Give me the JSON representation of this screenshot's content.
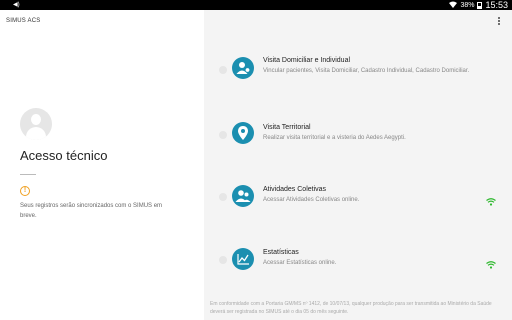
{
  "status_bar": {
    "left_icon": "volume-icon",
    "battery": "38%",
    "time": "15:53"
  },
  "app": {
    "title": "SIMUS ACS"
  },
  "left": {
    "heading": "Acesso técnico",
    "sync_message": "Seus registros serão sincronizados com o SIMUS em breve."
  },
  "items": [
    {
      "title": "Visita Domiciliar e Individual",
      "subtitle": "Vincular pacientes, Visita Domiciliar, Cadastro Individual, Cadastro Domiciliar.",
      "icon": "person-location-icon",
      "online": false
    },
    {
      "title": "Visita Territorial",
      "subtitle": "Realizar visita territorial e a visteria do Aedes Aegypti.",
      "icon": "map-pin-icon",
      "online": false
    },
    {
      "title": "Atividades Coletivas",
      "subtitle": "Acessar Atividades Coletivas online.",
      "icon": "group-icon",
      "online": true
    },
    {
      "title": "Estatísticas",
      "subtitle": "Acessar Estatísticas online.",
      "icon": "chart-icon",
      "online": true
    }
  ],
  "footer": "Em conformidade com a Portaria GM/MS nº 1412, de 10/07/13, qualquer produção para ser transmitida ao Ministério da Saúde deverá ser registrada no SIMUS até o dia 05 do mês seguinte.",
  "colors": {
    "accent": "#1b8fb0",
    "online": "#2eb82e",
    "warning": "#f0a020"
  }
}
